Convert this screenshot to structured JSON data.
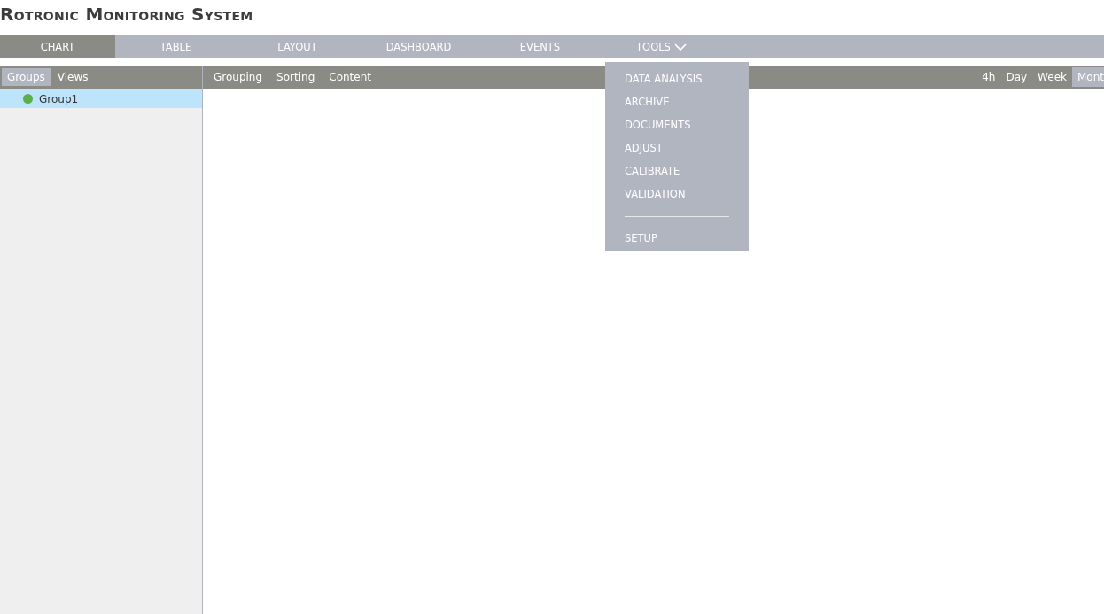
{
  "app_title": "Rotronic Monitoring System",
  "nav_tabs": [
    {
      "label": "CHART",
      "selected": true
    },
    {
      "label": "TABLE",
      "selected": false
    },
    {
      "label": "LAYOUT",
      "selected": false
    },
    {
      "label": "DASHBOARD",
      "selected": false
    },
    {
      "label": "EVENTS",
      "selected": false
    },
    {
      "label": "TOOLS",
      "selected": false,
      "dropdown": true
    }
  ],
  "sidebar": {
    "tabs": [
      {
        "label": "Groups",
        "selected": true
      },
      {
        "label": "Views",
        "selected": false
      }
    ],
    "items": [
      {
        "label": "Group1",
        "selected": true,
        "color": "#5cb04a"
      }
    ]
  },
  "toolbar": {
    "menus": [
      "Grouping",
      "Sorting",
      "Content"
    ],
    "ranges": [
      {
        "label": "4h",
        "selected": false
      },
      {
        "label": "Day",
        "selected": false
      },
      {
        "label": "Week",
        "selected": false
      },
      {
        "label": "Mont",
        "selected": true
      }
    ]
  },
  "tools_menu": [
    {
      "kind": "item",
      "label": "DATA ANALYSIS"
    },
    {
      "kind": "item",
      "label": "ARCHIVE"
    },
    {
      "kind": "item",
      "label": "DOCUMENTS"
    },
    {
      "kind": "item",
      "label": "ADJUST"
    },
    {
      "kind": "item",
      "label": "CALIBRATE"
    },
    {
      "kind": "item",
      "label": "VALIDATION"
    },
    {
      "kind": "separator"
    },
    {
      "kind": "item",
      "label": "SETUP"
    }
  ]
}
